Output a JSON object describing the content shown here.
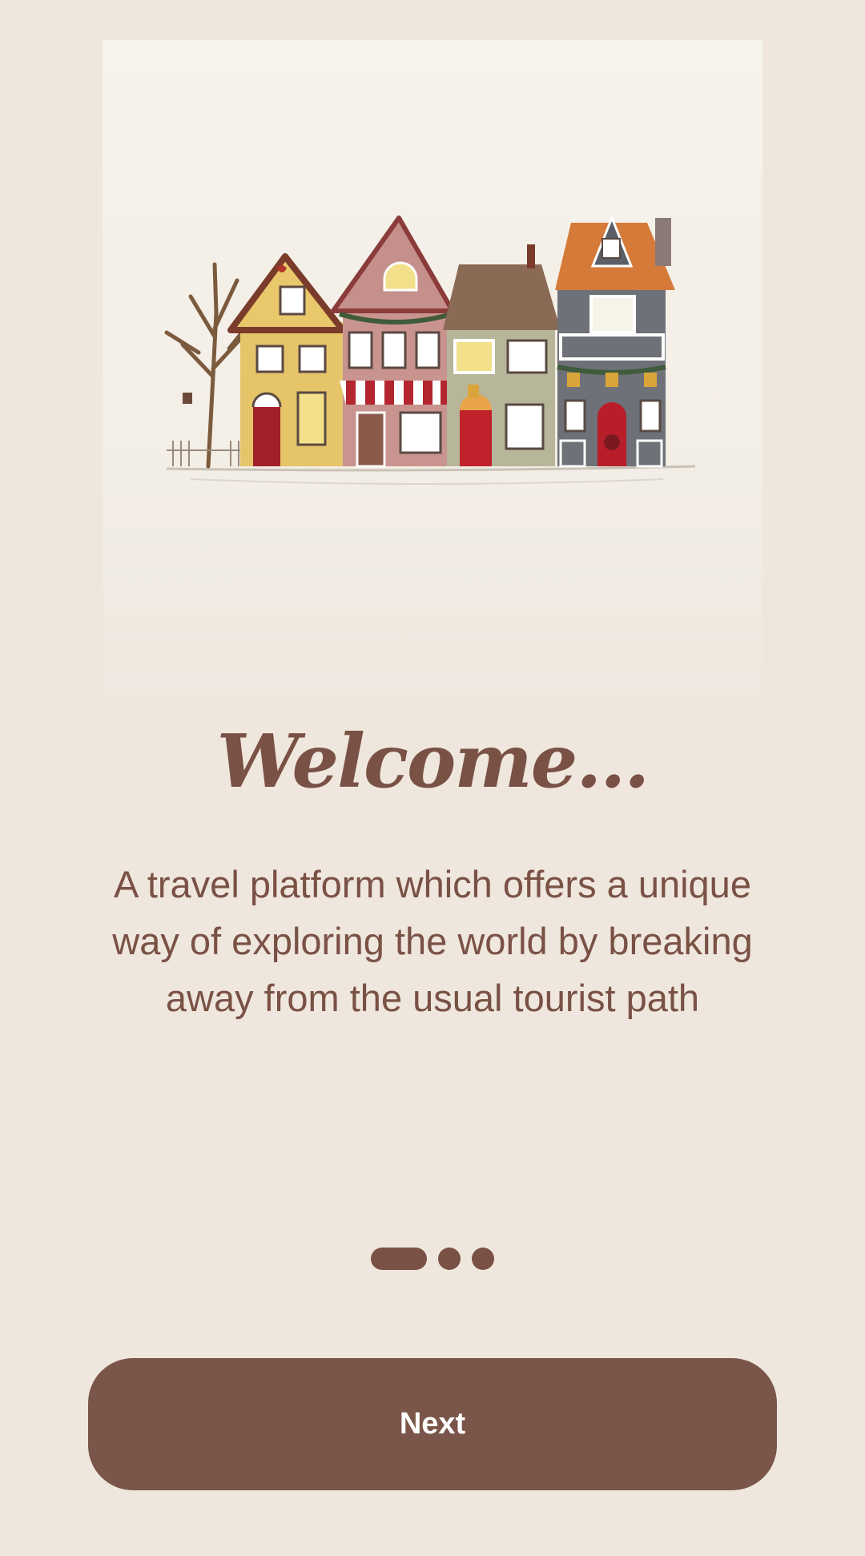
{
  "onboarding": {
    "title": "Welcome...",
    "description": "A travel platform which offers a unique way of exploring the world by breaking away from the usual tourist path",
    "pagination": {
      "total": 3,
      "current": 1
    },
    "next_label": "Next"
  },
  "colors": {
    "background": "#efe7dd",
    "accent": "#7a5549",
    "text": "#7a5145"
  },
  "icons": {
    "hero_illustration": "watercolor-houses-illustration"
  }
}
